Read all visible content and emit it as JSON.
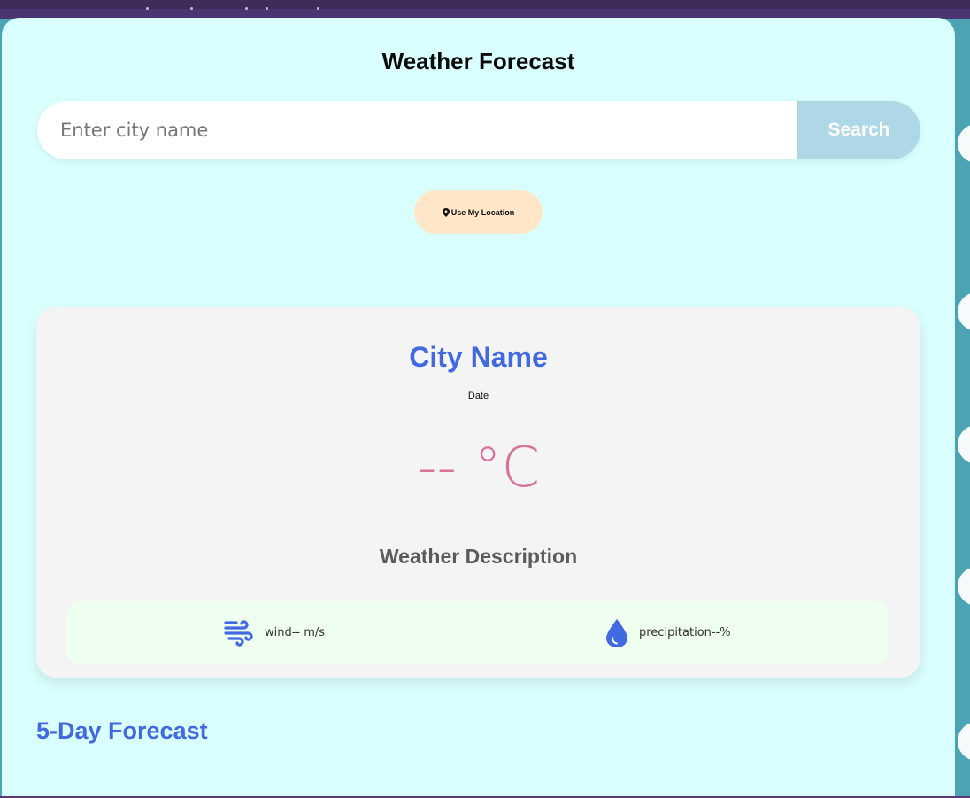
{
  "header": {
    "title": "Weather Forecast"
  },
  "search": {
    "placeholder": "Enter city name",
    "value": "",
    "button_label": "Search"
  },
  "location": {
    "button_label": "Use My Location",
    "icon": "map-pin-icon"
  },
  "current": {
    "city": "City Name",
    "date": "Date",
    "temperature": "-- °C",
    "description": "Weather Description",
    "wind": {
      "icon": "wind-icon",
      "label": "wind-- m/s"
    },
    "precipitation": {
      "icon": "droplet-icon",
      "label": "precipitation--%"
    }
  },
  "forecast": {
    "title": "5-Day Forecast"
  },
  "colors": {
    "accent": "#4169e1",
    "temperature": "#d9739a",
    "search_button": "#aed8e6",
    "location_button": "#ffe6c9",
    "background": "#daffff",
    "card": "#f4f4f4",
    "details": "#efffef"
  }
}
